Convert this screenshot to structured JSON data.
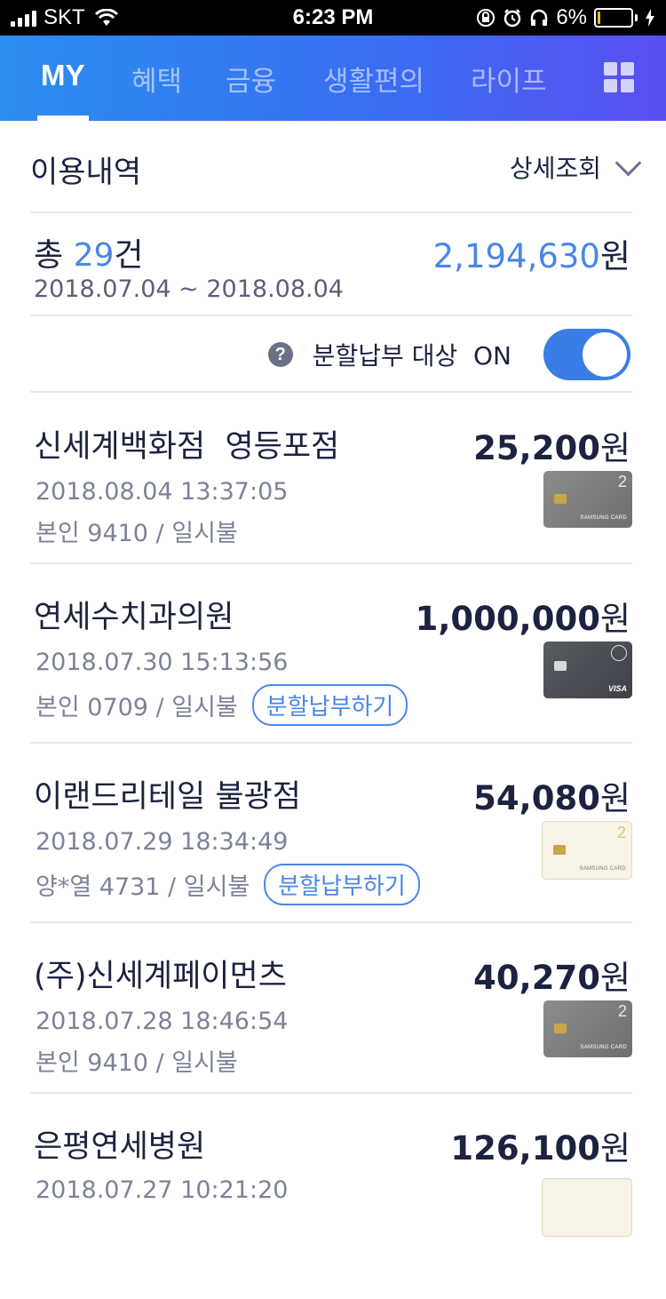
{
  "status_bar": {
    "carrier": "SKT",
    "time": "6:23 PM",
    "battery_text": "6%",
    "battery_level": 0.06
  },
  "tabs": [
    {
      "label": "MY",
      "active": true
    },
    {
      "label": "혜택",
      "active": false
    },
    {
      "label": "금융",
      "active": false
    },
    {
      "label": "생활편의",
      "active": false
    },
    {
      "label": "라이프",
      "active": false
    }
  ],
  "header": {
    "title": "이용내역",
    "detail_label": "상세조회"
  },
  "summary": {
    "total_prefix": "총",
    "total_count": "29",
    "total_suffix": "건",
    "total_amount": "2,194,630",
    "currency": "원",
    "period": "2018.07.04 ~ 2018.08.04"
  },
  "installment_filter": {
    "label": "분할납부 대상  ON",
    "help_glyph": "?",
    "enabled": true
  },
  "transactions": [
    {
      "merchant": "신세계백화점  영등포점",
      "amount": "25,200",
      "datetime": "2018.08.04 13:37:05",
      "detail": "본인 9410 / 일시불",
      "split_label": "",
      "card_style": "grey",
      "card_num": "2",
      "card_brand": "SAMSUNG CARD"
    },
    {
      "merchant": "연세수치과의원",
      "amount": "1,000,000",
      "datetime": "2018.07.30 15:13:56",
      "detail": "본인 0709 / 일시불",
      "split_label": "분할납부하기",
      "card_style": "dark",
      "card_num": "",
      "card_brand": "VISA"
    },
    {
      "merchant": "이랜드리테일 불광점",
      "amount": "54,080",
      "datetime": "2018.07.29 18:34:49",
      "detail": "양*열 4731 / 일시불",
      "split_label": "분할납부하기",
      "card_style": "cream",
      "card_num": "2",
      "card_brand": "SAMSUNG CARD"
    },
    {
      "merchant": "(주)신세계페이먼츠",
      "amount": "40,270",
      "datetime": "2018.07.28 18:46:54",
      "detail": "본인 9410 / 일시불",
      "split_label": "",
      "card_style": "grey",
      "card_num": "2",
      "card_brand": "SAMSUNG CARD"
    },
    {
      "merchant": "은평연세병원",
      "amount": "126,100",
      "datetime": "2018.07.27 10:21:20",
      "detail": "",
      "split_label": "",
      "card_style": "cream",
      "card_num": "",
      "card_brand": ""
    }
  ],
  "colors": {
    "accent_blue": "#4a86e8",
    "tab_gradient_start": "#2b8ef0",
    "tab_gradient_end": "#5a4ff0",
    "text_dark": "#1c2340",
    "text_grey": "#7d8297"
  }
}
